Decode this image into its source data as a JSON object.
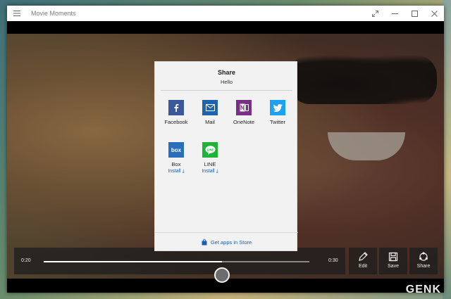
{
  "window": {
    "title": "Movie Moments"
  },
  "share": {
    "title": "Share",
    "subtitle": "Hello",
    "apps": [
      {
        "label": "Facebook",
        "icon": "facebook-icon",
        "color": "#3b5998"
      },
      {
        "label": "Mail",
        "icon": "mail-icon",
        "color": "#1d63ad"
      },
      {
        "label": "OneNote",
        "icon": "onenote-icon",
        "color": "#7a2f86"
      },
      {
        "label": "Twitter",
        "icon": "twitter-icon",
        "color": "#1da1f2"
      },
      {
        "label": "Box",
        "icon": "box-icon",
        "color": "#2a6ebb",
        "install": "Install"
      },
      {
        "label": "LINE",
        "icon": "line-icon",
        "color": "#1fb33a",
        "install": "Install"
      }
    ],
    "store_link": "Get apps in Store"
  },
  "player": {
    "current_time": "0:20",
    "total_time": "0:30",
    "progress": 0.67,
    "actions": [
      {
        "label": "Edit",
        "icon": "pencil-icon"
      },
      {
        "label": "Save",
        "icon": "floppy-disk-icon"
      },
      {
        "label": "Share",
        "icon": "share-icon"
      }
    ]
  },
  "watermark": "GENK"
}
